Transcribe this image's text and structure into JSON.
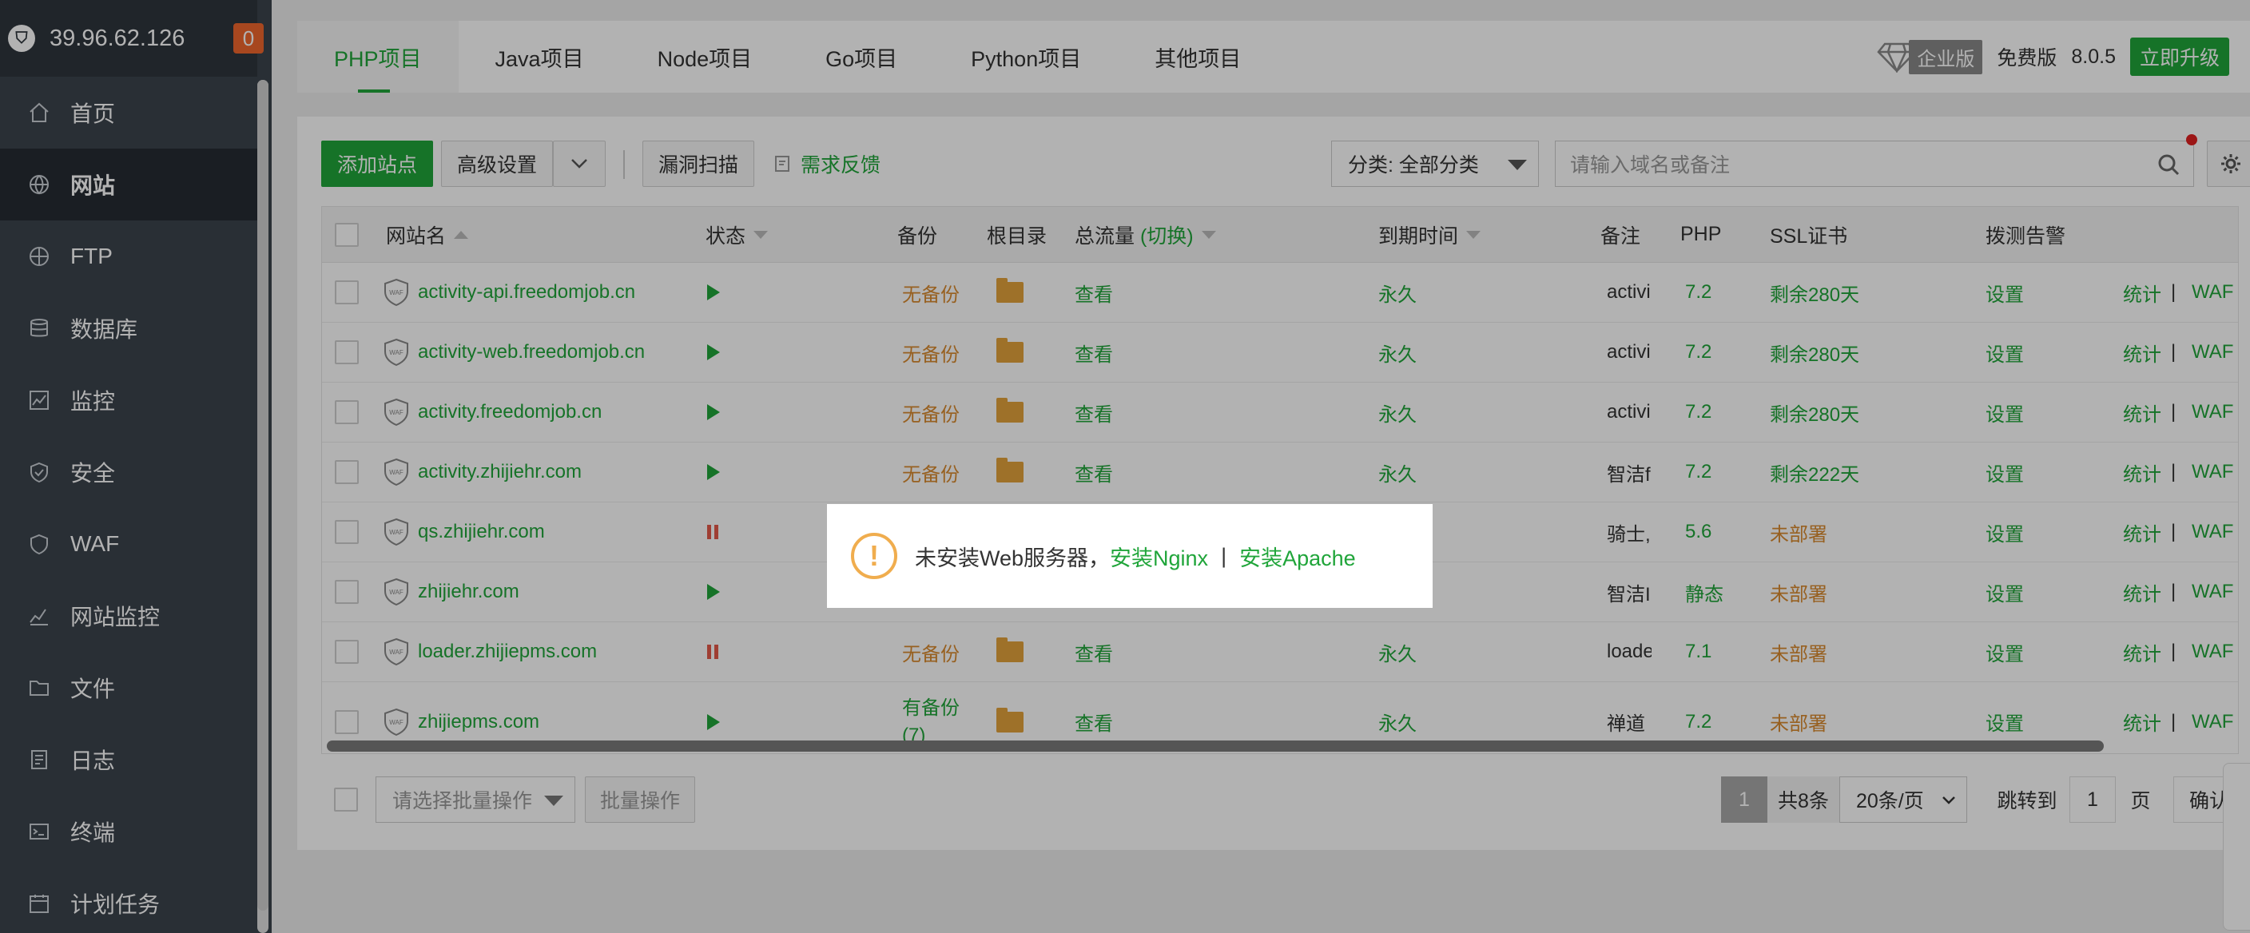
{
  "sidebar": {
    "ip": "39.96.62.126",
    "badge": "0",
    "items": [
      {
        "label": "首页",
        "icon": "home-icon"
      },
      {
        "label": "网站",
        "icon": "globe-icon"
      },
      {
        "label": "FTP",
        "icon": "ftp-icon"
      },
      {
        "label": "数据库",
        "icon": "database-icon"
      },
      {
        "label": "监控",
        "icon": "monitor-icon"
      },
      {
        "label": "安全",
        "icon": "shield-icon"
      },
      {
        "label": "WAF",
        "icon": "waf-icon"
      },
      {
        "label": "网站监控",
        "icon": "chart-icon"
      },
      {
        "label": "文件",
        "icon": "folder-icon"
      },
      {
        "label": "日志",
        "icon": "log-icon"
      },
      {
        "label": "终端",
        "icon": "terminal-icon"
      },
      {
        "label": "计划任务",
        "icon": "calendar-icon"
      }
    ]
  },
  "tabs": [
    "PHP项目",
    "Java项目",
    "Node项目",
    "Go项目",
    "Python项目",
    "其他项目"
  ],
  "header_right": {
    "enterprise": "企业版",
    "free": "免费版",
    "version": "8.0.5",
    "upgrade": "立即升级"
  },
  "toolbar": {
    "add_site": "添加站点",
    "advanced": "高级设置",
    "scan": "漏洞扫描",
    "feedback": "需求反馈",
    "category": "分类: 全部分类",
    "search_placeholder": "请输入域名或备注"
  },
  "table": {
    "headers": {
      "name": "网站名",
      "status": "状态",
      "backup": "备份",
      "root": "根目录",
      "traffic": "总流量",
      "traffic_switch": "(切换)",
      "expire": "到期时间",
      "note": "备注",
      "php": "PHP",
      "ssl": "SSL证书",
      "alert": "拨测告警"
    },
    "rows": [
      {
        "name": "activity-api.freedomjob.cn",
        "backup": "无备份",
        "traffic": "查看",
        "expire": "永久",
        "note": "activi",
        "php": "7.2",
        "ssl": "剩余280天",
        "alert": "设置",
        "stat": "统计",
        "waf": "WAF"
      },
      {
        "name": "activity-web.freedomjob.cn",
        "backup": "无备份",
        "traffic": "查看",
        "expire": "永久",
        "note": "activi",
        "php": "7.2",
        "ssl": "剩余280天",
        "alert": "设置",
        "stat": "统计",
        "waf": "WAF"
      },
      {
        "name": "activity.freedomjob.cn",
        "backup": "无备份",
        "traffic": "查看",
        "expire": "永久",
        "note": "activi",
        "php": "7.2",
        "ssl": "剩余280天",
        "alert": "设置",
        "stat": "统计",
        "waf": "WAF"
      },
      {
        "name": "activity.zhijiehr.com",
        "backup": "无备份",
        "traffic": "查看",
        "expire": "永久",
        "note": "智洁f",
        "php": "7.2",
        "ssl": "剩余222天",
        "alert": "设置",
        "stat": "统计",
        "waf": "WAF"
      },
      {
        "name": "qs.zhijiehr.com",
        "backup": "",
        "traffic": "",
        "expire": "",
        "note": "骑士,",
        "php": "5.6",
        "ssl": "未部署",
        "alert": "设置",
        "stat": "统计",
        "waf": "WAF"
      },
      {
        "name": "zhijiehr.com",
        "backup": "",
        "traffic": "",
        "expire": "",
        "note": "智洁I",
        "php": "静态",
        "ssl": "未部署",
        "alert": "设置",
        "stat": "统计",
        "waf": "WAF"
      },
      {
        "name": "loader.zhijiepms.com",
        "backup": "无备份",
        "traffic": "查看",
        "expire": "永久",
        "note": "loade",
        "php": "7.1",
        "ssl": "未部署",
        "alert": "设置",
        "stat": "统计",
        "waf": "WAF"
      },
      {
        "name": "zhijiepms.com",
        "backup": "有备份",
        "backup2": "(7)",
        "traffic": "查看",
        "expire": "永久",
        "note": "禅道",
        "php": "7.2",
        "ssl": "未部署",
        "alert": "设置",
        "stat": "统计",
        "waf": "WAF"
      }
    ]
  },
  "footer": {
    "batch_placeholder": "请选择批量操作",
    "batch_button": "批量操作",
    "page": "1",
    "total": "共8条",
    "per_page": "20条/页",
    "jump_label": "跳转到",
    "jump_value": "1",
    "page_unit": "页",
    "confirm": "确认"
  },
  "dialog": {
    "message": "未安装Web服务器，",
    "link1": "安装Nginx",
    "sep": "|",
    "link2": "安装Apache"
  }
}
